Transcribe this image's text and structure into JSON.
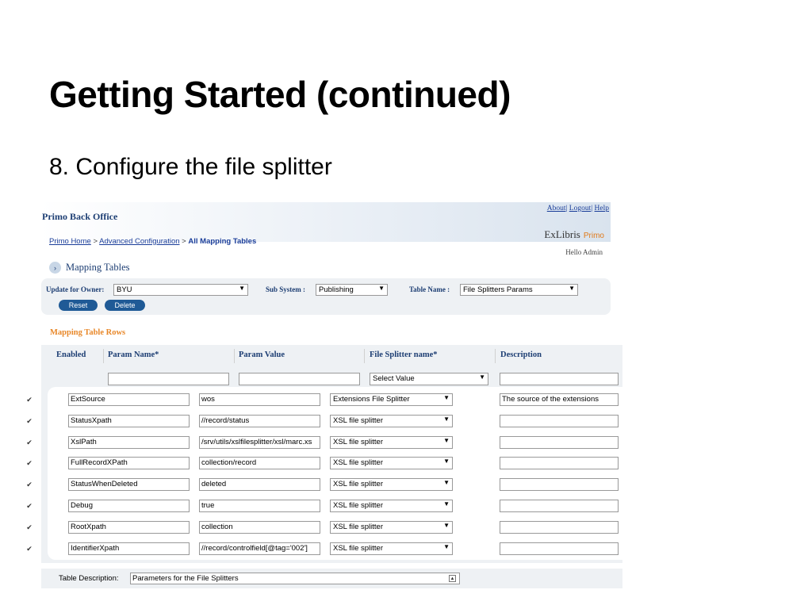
{
  "slide": {
    "title": "Getting Started (continued)",
    "subtitle": "8. Configure the file splitter"
  },
  "app": {
    "title": "Primo Back Office",
    "links": [
      "About",
      "Logout",
      "Help"
    ],
    "logo_text": "ExLibris",
    "logo_product": "Primo",
    "breadcrumb": {
      "home": "Primo Home",
      "sep": ">",
      "advanced": "Advanced Configuration",
      "current": "All Mapping Tables"
    },
    "greeting": "Hello Admin",
    "section_title": "Mapping Tables"
  },
  "owner_panel": {
    "owner_label": "Update for Owner:",
    "owner_value": "BYU",
    "subsystem_label": "Sub System :",
    "subsystem_value": "Publishing",
    "table_label": "Table Name :",
    "table_value": "File Splitters Params",
    "reset_label": "Reset",
    "delete_label": "Delete"
  },
  "table": {
    "title": "Mapping Table Rows",
    "headers": {
      "enabled": "Enabled",
      "param_name": "Param Name*",
      "param_value": "Param Value",
      "splitter": "File Splitter name*",
      "description": "Description"
    },
    "filter_select": "Select Value",
    "rows": [
      {
        "name": "ExtSource",
        "value": "wos",
        "splitter": "Extensions File Splitter",
        "description": "The source of the extensions"
      },
      {
        "name": "StatusXpath",
        "value": "//record/status",
        "splitter": "XSL file splitter",
        "description": ""
      },
      {
        "name": "XslPath",
        "value": "/srv/utils/xslfilesplitter/xsl/marc.xs",
        "splitter": "XSL file splitter",
        "description": ""
      },
      {
        "name": "FullRecordXPath",
        "value": "collection/record",
        "splitter": "XSL file splitter",
        "description": ""
      },
      {
        "name": "StatusWhenDeleted",
        "value": "deleted",
        "splitter": "XSL file splitter",
        "description": ""
      },
      {
        "name": "Debug",
        "value": "true",
        "splitter": "XSL file splitter",
        "description": ""
      },
      {
        "name": "RootXpath",
        "value": "collection",
        "splitter": "XSL file splitter",
        "description": ""
      },
      {
        "name": "IdentifierXpath",
        "value": "//record/controlfield[@tag='002']",
        "splitter": "XSL file splitter",
        "description": ""
      }
    ]
  },
  "table_description": {
    "label": "Table Description:",
    "value": "Parameters for the File Splitters"
  },
  "icons": {
    "checkbox_glyph": "✔",
    "dropdown_glyph": "▼",
    "section_glyph": "›"
  }
}
